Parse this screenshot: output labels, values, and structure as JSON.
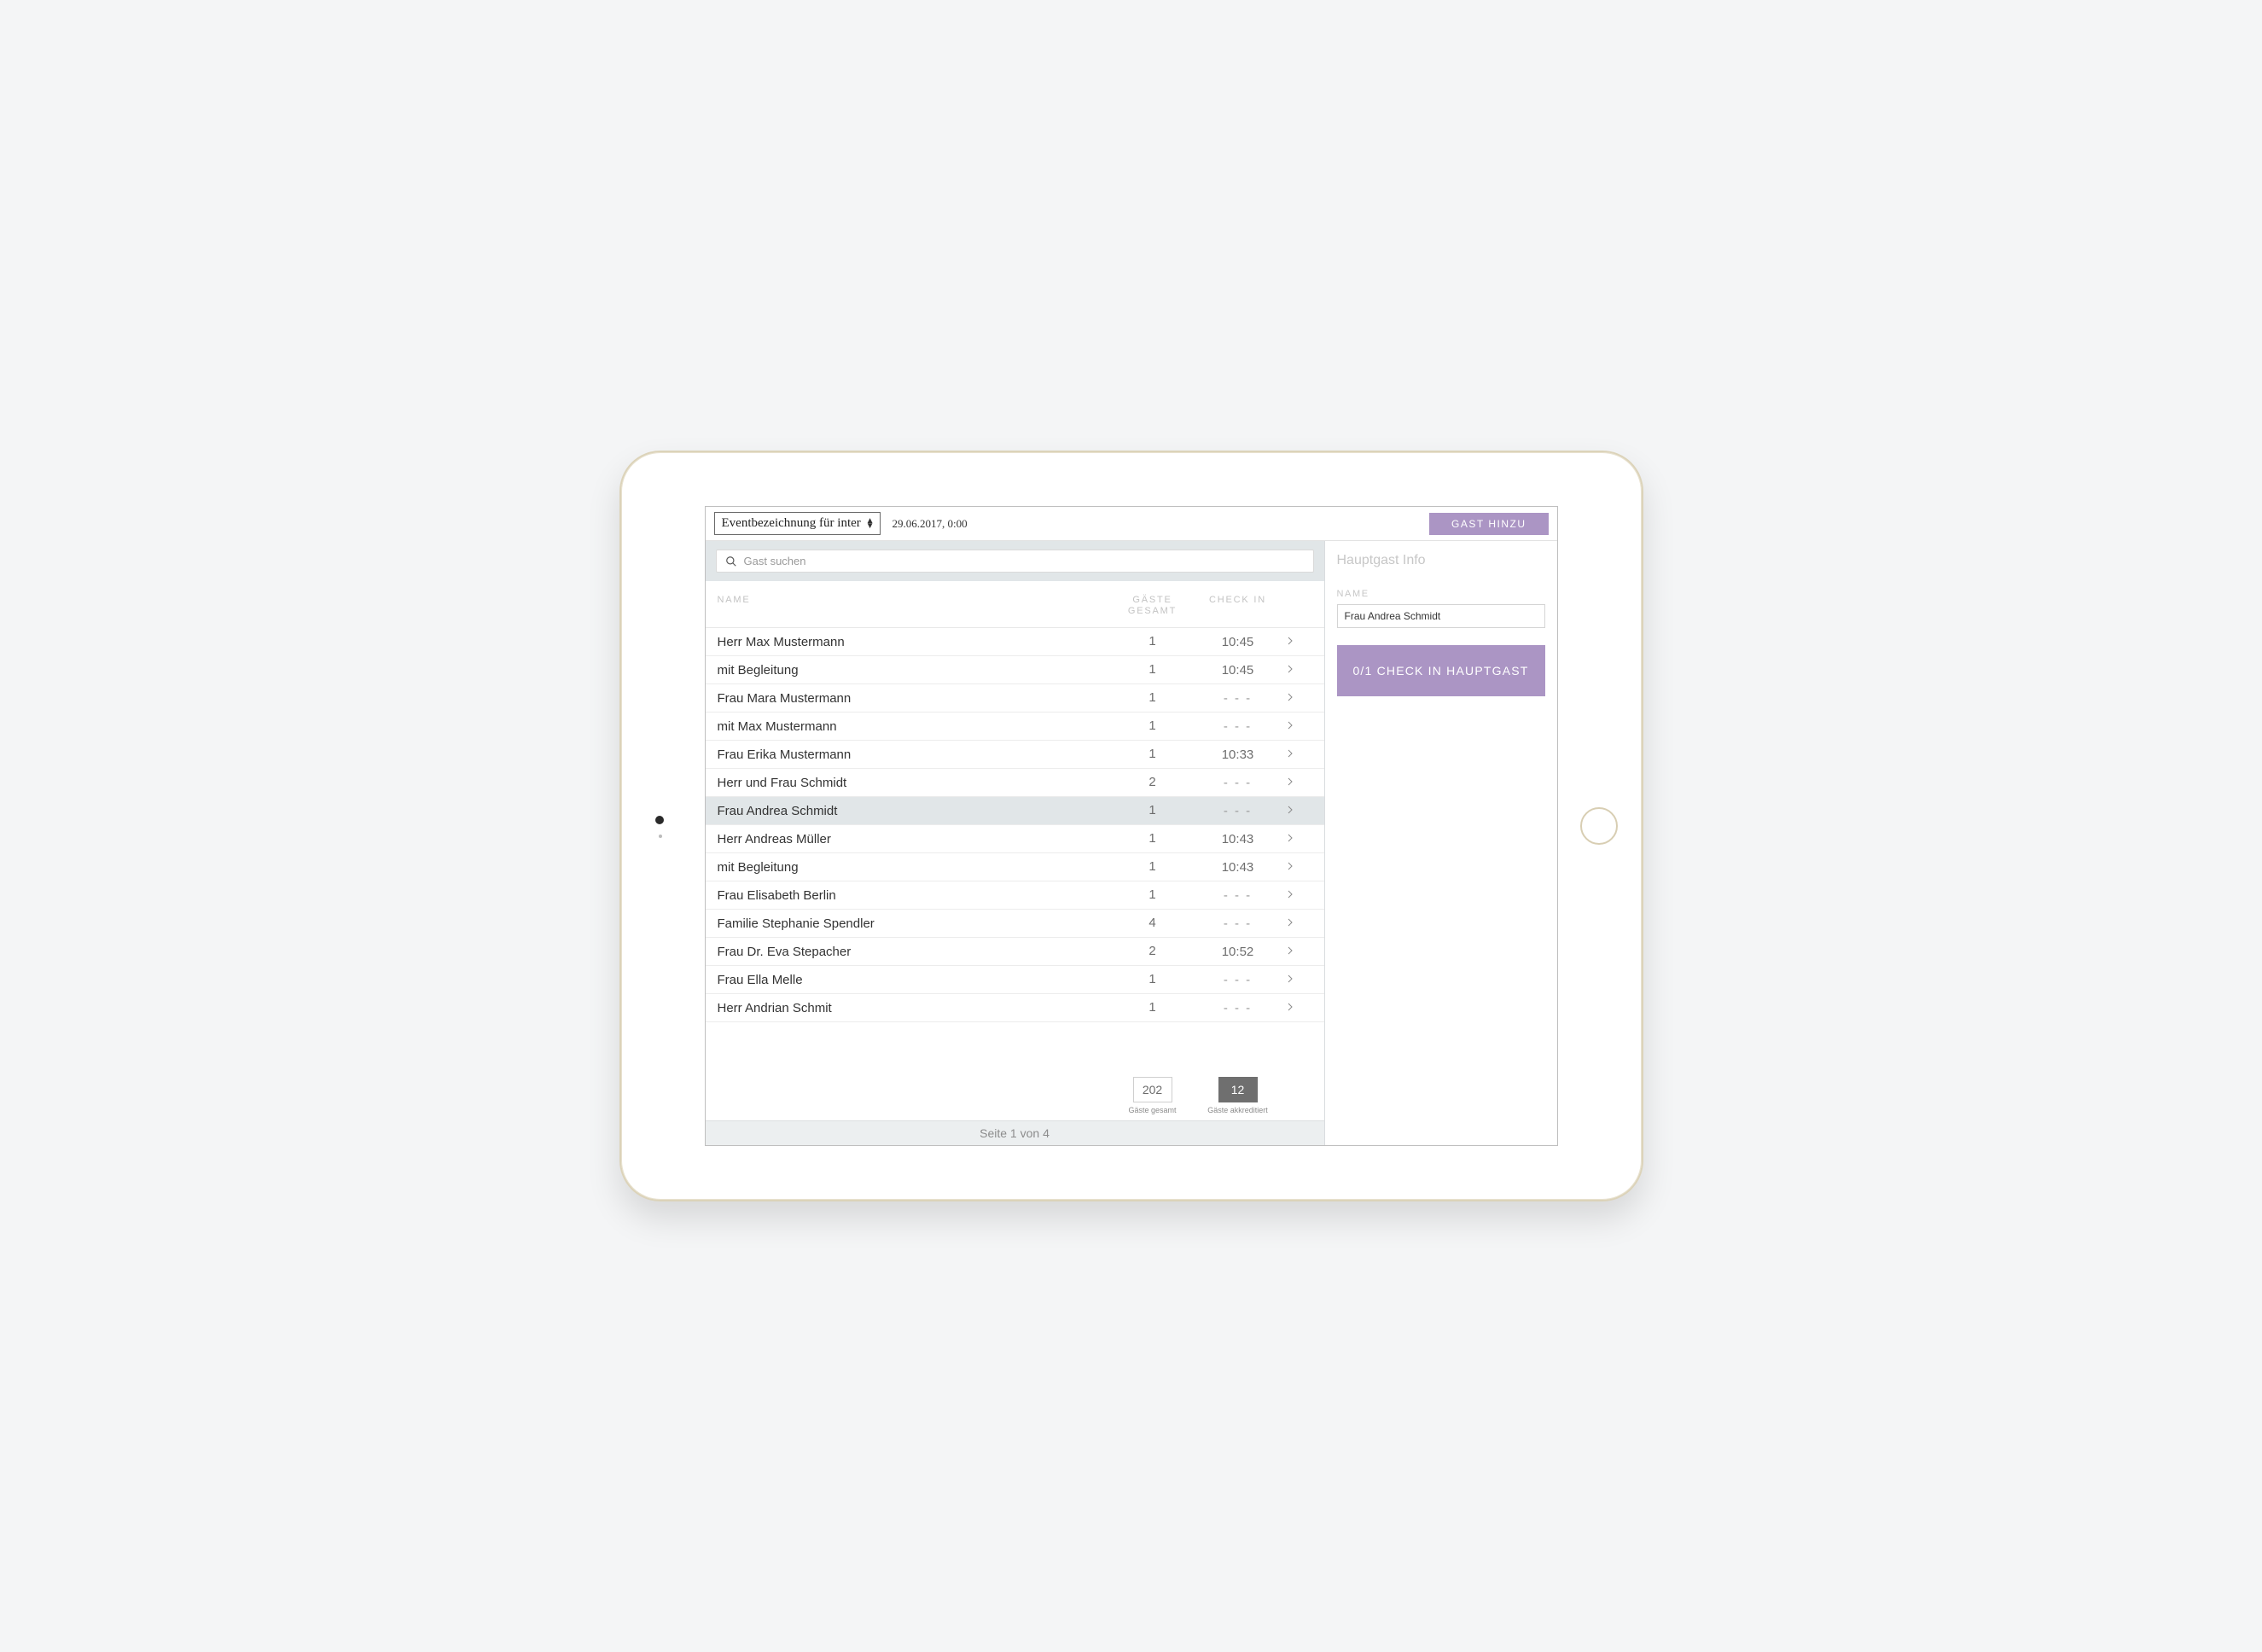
{
  "topbar": {
    "event_select_label": "Eventbezeichnung für inter",
    "event_date": "29.06.2017, 0:00",
    "add_guest_label": "GAST HINZU"
  },
  "search": {
    "placeholder": "Gast suchen"
  },
  "columns": {
    "name": "NAME",
    "count": "GÄSTE GESAMT",
    "checkin": "CHECK IN"
  },
  "guests": [
    {
      "name": "Herr Max Mustermann",
      "count": "1",
      "checkin": "10:45",
      "selected": false
    },
    {
      "name": "mit Begleitung",
      "count": "1",
      "checkin": "10:45",
      "selected": false
    },
    {
      "name": "Frau Mara Mustermann",
      "count": "1",
      "checkin": "- - -",
      "selected": false
    },
    {
      "name": "mit Max Mustermann",
      "count": "1",
      "checkin": "- - -",
      "selected": false
    },
    {
      "name": "Frau Erika Mustermann",
      "count": "1",
      "checkin": "10:33",
      "selected": false
    },
    {
      "name": "Herr und Frau Schmidt",
      "count": "2",
      "checkin": "- - -",
      "selected": false
    },
    {
      "name": "Frau Andrea Schmidt",
      "count": "1",
      "checkin": "- - -",
      "selected": true
    },
    {
      "name": "Herr Andreas Müller",
      "count": "1",
      "checkin": "10:43",
      "selected": false
    },
    {
      "name": "mit Begleitung",
      "count": "1",
      "checkin": "10:43",
      "selected": false
    },
    {
      "name": "Frau Elisabeth Berlin",
      "count": "1",
      "checkin": "- - -",
      "selected": false
    },
    {
      "name": "Familie Stephanie Spendler",
      "count": "4",
      "checkin": "- - -",
      "selected": false
    },
    {
      "name": "Frau  Dr. Eva Stepacher",
      "count": "2",
      "checkin": "10:52",
      "selected": false
    },
    {
      "name": "Frau Ella Melle",
      "count": "1",
      "checkin": "- - -",
      "selected": false
    },
    {
      "name": "Herr Andrian Schmit",
      "count": "1",
      "checkin": "- - -",
      "selected": false
    }
  ],
  "footer": {
    "total_count": "202",
    "accredited_count": "12",
    "total_label": "Gäste gesamt",
    "accredited_label": "Gäste akkreditiert"
  },
  "pager": {
    "text": "Seite 1 von 4"
  },
  "side": {
    "title": "Hauptgast Info",
    "name_label": "NAME",
    "name_value": "Frau Andrea Schmidt",
    "checkin_button": "0/1 CHECK IN HAUPTGAST"
  }
}
